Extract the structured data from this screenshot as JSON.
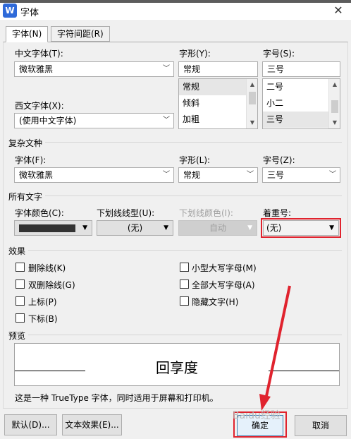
{
  "window": {
    "title": "字体",
    "app_icon_letter": "W",
    "close": "✕"
  },
  "tabs": [
    {
      "label": "字体(N)"
    },
    {
      "label": "字符间距(R)"
    }
  ],
  "chinese_font": {
    "label": "中文字体(T):",
    "value": "微软雅黑"
  },
  "western_font": {
    "label": "西文字体(X):",
    "value": "(使用中文字体)"
  },
  "style": {
    "label": "字形(Y):",
    "value": "常规",
    "options": [
      "常规",
      "倾斜",
      "加粗"
    ],
    "selected_index": 0
  },
  "size": {
    "label": "字号(S):",
    "value": "三号",
    "options": [
      "二号",
      "小二",
      "三号"
    ],
    "selected_index": 2
  },
  "complex": {
    "group_title": "复杂文种",
    "font_label": "字体(F):",
    "font_value": "微软雅黑",
    "style_label": "字形(L):",
    "style_value": "常规",
    "size_label": "字号(Z):",
    "size_value": "三号"
  },
  "all_text": {
    "group_title": "所有文字",
    "font_color_label": "字体颜色(C):",
    "font_color": "#333333",
    "underline_type_label": "下划线线型(U):",
    "underline_type_value": "(无)",
    "underline_color_label": "下划线颜色(I):",
    "underline_color_value": "自动",
    "emphasis_label": "着重号:",
    "emphasis_value": "(无)"
  },
  "effects": {
    "group_title": "效果",
    "left": [
      {
        "label": "删除线(K)"
      },
      {
        "label": "双删除线(G)"
      },
      {
        "label": "上标(P)"
      },
      {
        "label": "下标(B)"
      }
    ],
    "right": [
      {
        "label": "小型大写字母(M)"
      },
      {
        "label": "全部大写字母(A)"
      },
      {
        "label": "隐藏文字(H)"
      }
    ]
  },
  "preview": {
    "group_title": "预览",
    "sample_text": "回享度"
  },
  "info_text": "这是一种 TrueType 字体，同时适用于屏幕和打印机。",
  "buttons": {
    "default": "默认(D)...",
    "text_effects": "文本效果(E)...",
    "ok": "确定",
    "cancel": "取消"
  },
  "colors": {
    "highlight": "#e0232e",
    "accent": "#2f6ad9"
  },
  "watermark": "Baidu经验"
}
